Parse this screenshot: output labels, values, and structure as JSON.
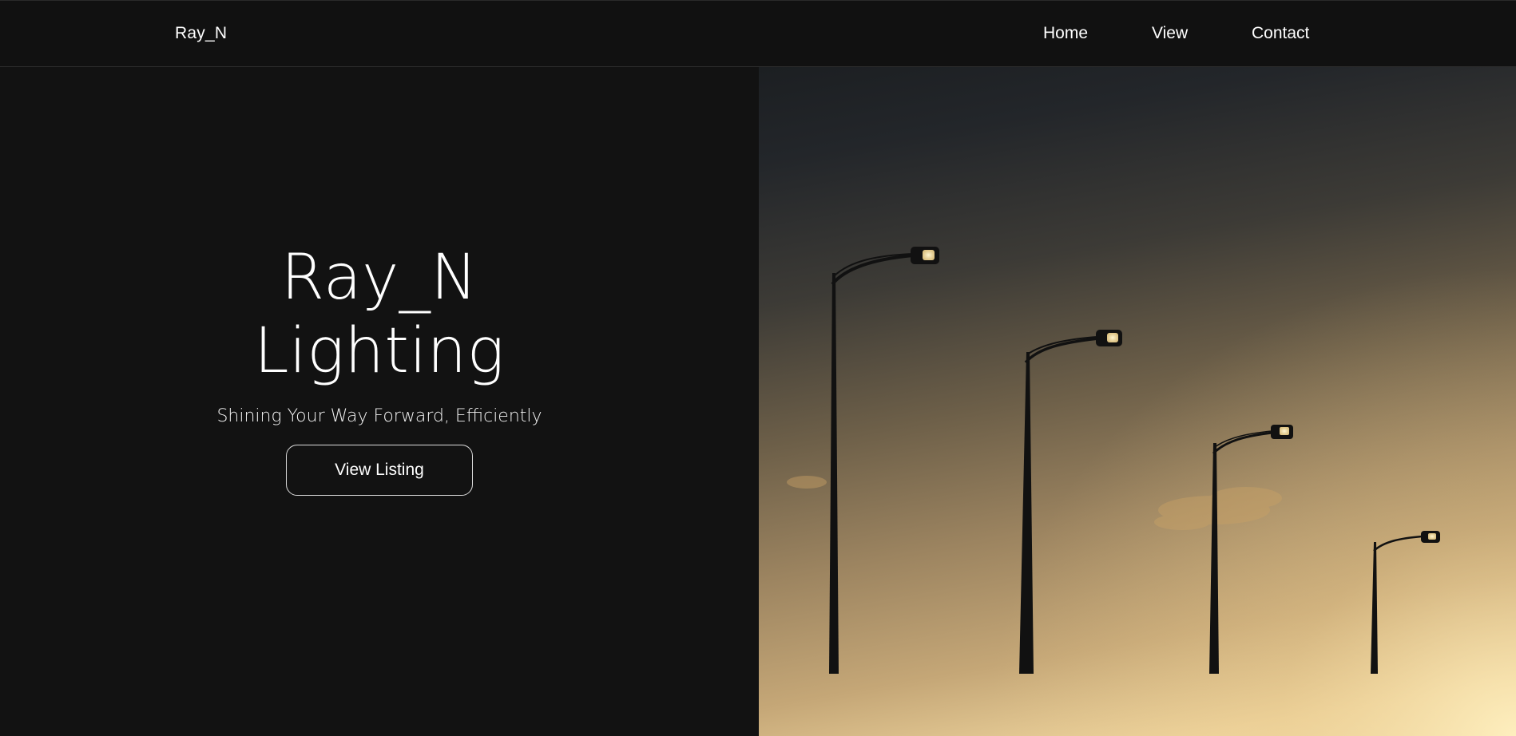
{
  "header": {
    "brand": "Ray_N",
    "nav": [
      {
        "label": "Home"
      },
      {
        "label": "View"
      },
      {
        "label": "Contact"
      }
    ]
  },
  "hero": {
    "title_line1": "Ray_N",
    "title_line2": "Lighting",
    "subtitle": "Shining Your Way Forward, Efficiently",
    "button_label": "View Listing",
    "image_subject": "street lamps at dusk"
  },
  "colors": {
    "background": "#121212",
    "navbar": "#111111",
    "text": "#ffffff",
    "sky_top": "#1c1f22",
    "sky_bottom": "#f6e2ad",
    "lamp_glow": "#fff3c8"
  }
}
